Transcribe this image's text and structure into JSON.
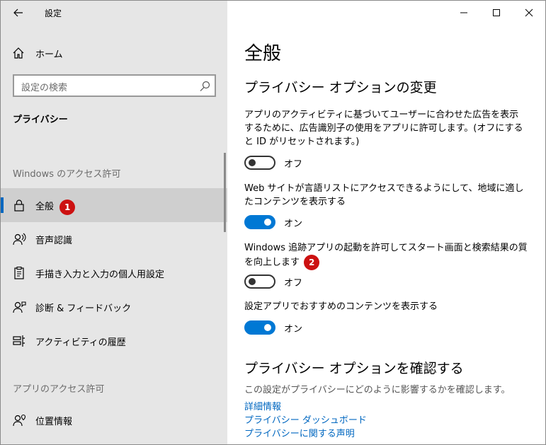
{
  "app": {
    "title": "設定"
  },
  "colors": {
    "accent": "#0078d4",
    "badge": "#cc1111",
    "sidebar_bg": "#e6e6e6",
    "selected_bg": "#cfcfcf"
  },
  "sidebar": {
    "home_label": "ホーム",
    "search_placeholder": "設定の検索",
    "section_title": "プライバシー",
    "group1_label": "Windows のアクセス許可",
    "group2_label": "アプリのアクセス許可",
    "items": [
      {
        "label": "全般",
        "icon": "lock-icon",
        "selected": true,
        "badge": "1"
      },
      {
        "label": "音声認識",
        "icon": "speech-icon"
      },
      {
        "label": "手描き入力と入力の個人用設定",
        "icon": "clipboard-icon"
      },
      {
        "label": "診断 & フィードバック",
        "icon": "feedback-person-icon"
      },
      {
        "label": "アクティビティの履歴",
        "icon": "timeline-icon"
      },
      {
        "label": "位置情報",
        "icon": "location-person-icon"
      }
    ]
  },
  "main": {
    "page_title": "全般",
    "section1_heading": "プライバシー オプションの変更",
    "settings": [
      {
        "description": "アプリのアクティビティに基づいてユーザーに合わせた広告を表示するために、広告識別子の使用をアプリに許可します。(オフにすると ID がリセットされます。)",
        "state": "off",
        "state_label": "オフ"
      },
      {
        "description": "Web サイトが言語リストにアクセスできるようにして、地域に適したコンテンツを表示する",
        "state": "on",
        "state_label": "オン"
      },
      {
        "description": "Windows 追跡アプリの起動を許可してスタート画面と検索結果の質を向上します",
        "state": "off",
        "state_label": "オフ",
        "badge": "2"
      },
      {
        "description": "設定アプリでおすすめのコンテンツを表示する",
        "state": "on",
        "state_label": "オン"
      }
    ],
    "section2_heading": "プライバシー オプションを確認する",
    "section2_text": "この設定がプライバシーにどのように影響するかを確認します。",
    "links": [
      "詳細情報",
      "プライバシー ダッシュボード",
      "プライバシーに関する声明"
    ]
  }
}
